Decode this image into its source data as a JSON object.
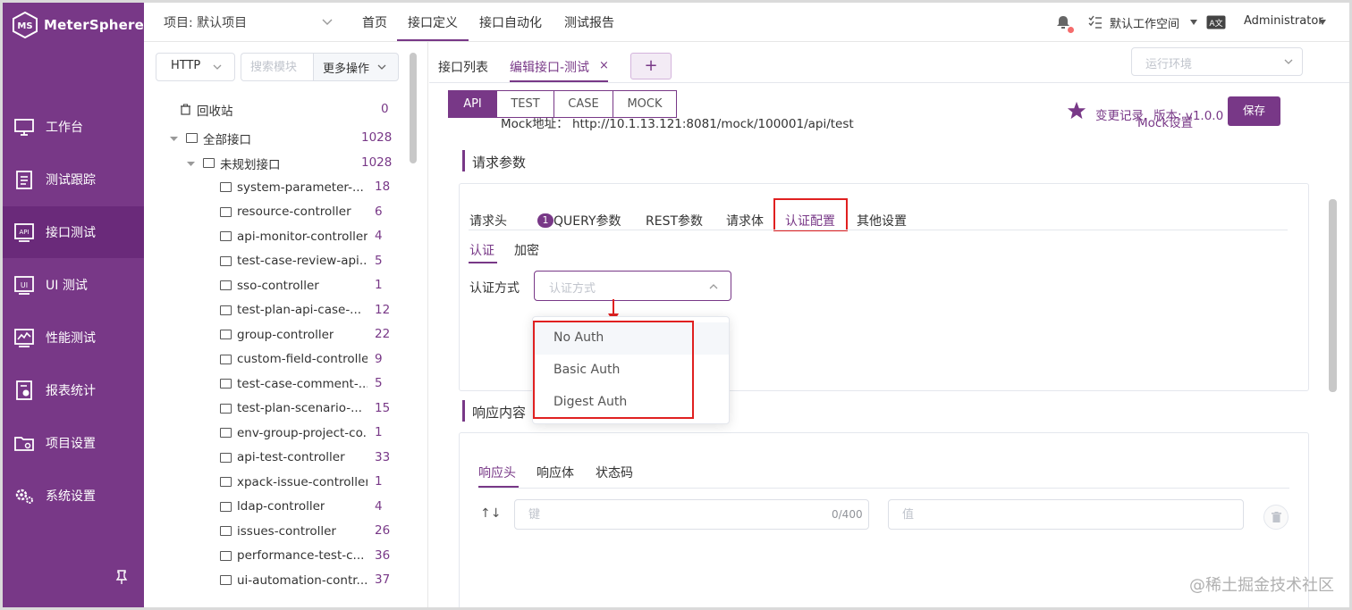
{
  "app": {
    "name": "MeterSphere",
    "project_label": "项目: 默认项目",
    "workspace": "默认工作空间",
    "user": "Administrator",
    "lang_icon": "A文",
    "accent_color": "#783887",
    "highlight_color": "#e02020"
  },
  "top_nav": [
    "首页",
    "接口定义",
    "接口自动化",
    "测试报告"
  ],
  "sidebar": {
    "items": [
      {
        "label": "工作台",
        "icon": "monitor-icon"
      },
      {
        "label": "测试跟踪",
        "icon": "clipboard-icon"
      },
      {
        "label": "接口测试",
        "icon": "api-icon",
        "active": true
      },
      {
        "label": "UI 测试",
        "icon": "ui-test-icon"
      },
      {
        "label": "性能测试",
        "icon": "performance-chart-icon"
      },
      {
        "label": "报表统计",
        "icon": "report-icon"
      },
      {
        "label": "项目设置",
        "icon": "folder-settings-icon"
      },
      {
        "label": "系统设置",
        "icon": "gears-icon"
      }
    ]
  },
  "module_panel": {
    "protocol": "HTTP",
    "search_placeholder": "搜索模块",
    "more_ops": "更多操作",
    "recycle": {
      "label": "回收站",
      "count": "0"
    },
    "all": {
      "label": "全部接口",
      "count": "1028"
    },
    "unplanned": {
      "label": "未规划接口",
      "count": "1028"
    },
    "modules": [
      {
        "label": "system-parameter-...",
        "count": "18"
      },
      {
        "label": "resource-controller",
        "count": "6"
      },
      {
        "label": "api-monitor-controller",
        "count": "4"
      },
      {
        "label": "test-case-review-api...",
        "count": "5"
      },
      {
        "label": "sso-controller",
        "count": "1"
      },
      {
        "label": "test-plan-api-case-...",
        "count": "12"
      },
      {
        "label": "group-controller",
        "count": "22"
      },
      {
        "label": "custom-field-controller",
        "count": "9"
      },
      {
        "label": "test-case-comment-...",
        "count": "5"
      },
      {
        "label": "test-plan-scenario-...",
        "count": "15"
      },
      {
        "label": "env-group-project-co...",
        "count": "1"
      },
      {
        "label": "api-test-controller",
        "count": "33"
      },
      {
        "label": "xpack-issue-controller",
        "count": "1"
      },
      {
        "label": "ldap-controller",
        "count": "4"
      },
      {
        "label": "issues-controller",
        "count": "26"
      },
      {
        "label": "performance-test-c...",
        "count": "36"
      },
      {
        "label": "ui-automation-contr...",
        "count": "37"
      }
    ]
  },
  "tabs": {
    "api_list": "接口列表",
    "edit": "编辑接口-测试",
    "close": "×",
    "add": "+",
    "env_placeholder": "运行环境"
  },
  "editor": {
    "modes": [
      "API",
      "TEST",
      "CASE",
      "MOCK"
    ],
    "mock_addr": "Mock地址：  http://10.1.13.121:8081/mock/100001/api/test",
    "history": "变更记录",
    "version": "版本: v1.0.0",
    "mock_settings": "Mock设置",
    "save": "保存"
  },
  "request": {
    "title": "请求参数",
    "tabs": [
      "请求头",
      "QUERY参数",
      "REST参数",
      "请求体",
      "认证配置",
      "其他设置"
    ],
    "header_count": "1",
    "sub_tabs": [
      "认证",
      "加密"
    ],
    "auth_label": "认证方式",
    "auth_placeholder": "认证方式",
    "auth_options": [
      "No Auth",
      "Basic Auth",
      "Digest Auth"
    ]
  },
  "response": {
    "title": "响应内容",
    "tabs": [
      "响应头",
      "响应体",
      "状态码"
    ],
    "sort_icon": "↑↓",
    "key_placeholder": "键",
    "key_counter": "0/400",
    "value_placeholder": "值"
  },
  "watermark": "@稀土掘金技术社区"
}
